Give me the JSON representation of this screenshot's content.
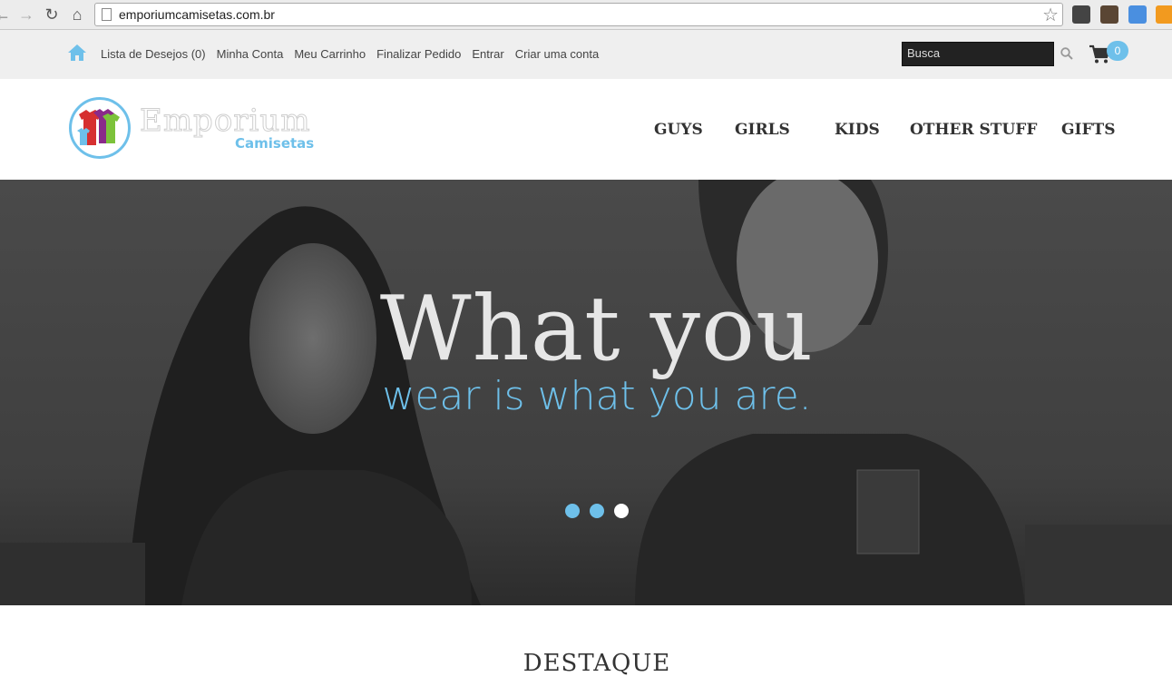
{
  "browser": {
    "url": "emporiumcamisetas.com.br"
  },
  "topbar": {
    "links": [
      "Lista de Desejos (0)",
      "Minha Conta",
      "Meu Carrinho",
      "Finalizar Pedido",
      "Entrar",
      "Criar uma conta"
    ],
    "search_placeholder": "Busca",
    "cart_count": "0"
  },
  "logo": {
    "word1": "Emporium",
    "word2": "Camisetas"
  },
  "nav": {
    "items": [
      "GUYS",
      "GIRLS",
      "KIDS",
      "OTHER STUFF",
      "GIFTS"
    ]
  },
  "hero": {
    "title": "What you",
    "subtitle": "wear is what you are.",
    "slide_count": 3,
    "active_slide": 3
  },
  "section": {
    "title": "DESTAQUE"
  },
  "colors": {
    "accent": "#6ec0ea",
    "nav_text": "#333333",
    "topbar_bg": "#efefef"
  }
}
